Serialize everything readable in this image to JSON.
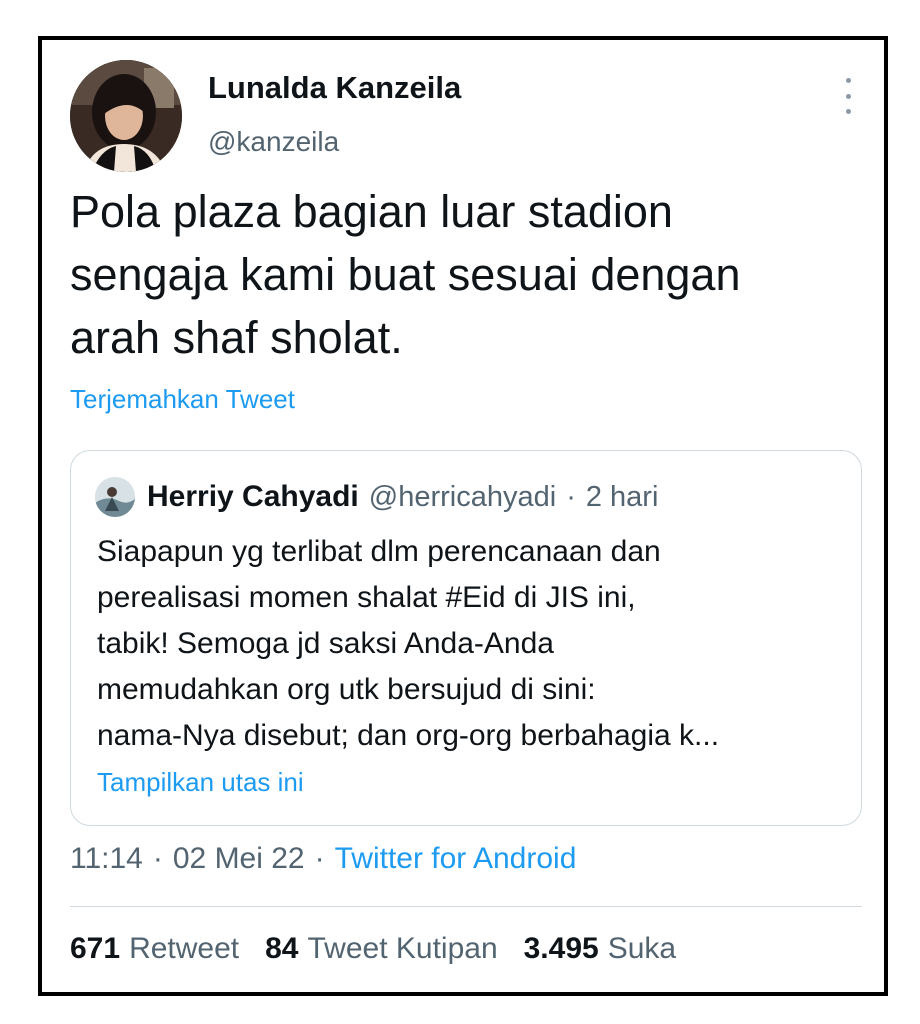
{
  "tweet": {
    "author_name": "Lunalda Kanzeila",
    "author_handle": "@kanzeila",
    "text_lines": [
      "Pola plaza bagian luar stadion",
      "sengaja kami buat sesuai dengan",
      "arah shaf sholat."
    ],
    "translate_label": "Terjemahkan Tweet",
    "time": "11:14",
    "date": "02 Mei 22",
    "source": "Twitter for Android",
    "separator": "·"
  },
  "quote": {
    "author_name": "Herriy Cahyadi",
    "author_handle": "@herricahyadi",
    "separator": "·",
    "time_ago": "2 hari",
    "text_lines": [
      "Siapapun yg terlibat dlm perencanaan dan",
      "perealisasi momen shalat #Eid di JIS ini,",
      "tabik! Semoga jd saksi Anda-Anda",
      "memudahkan org utk bersujud di sini:",
      "nama-Nya disebut; dan org-org berbahagia k..."
    ],
    "show_thread_label": "Tampilkan utas ini"
  },
  "stats": {
    "retweets_count": "671",
    "retweets_label": "Retweet",
    "quotes_count": "84",
    "quotes_label": "Tweet Kutipan",
    "likes_count": "3.495",
    "likes_label": "Suka"
  },
  "icons": {
    "more": "more-vertical-icon"
  },
  "colors": {
    "link": "#1d9bf0",
    "secondary_text": "#536471",
    "primary_text": "#0f1419",
    "border": "#cfd9de"
  }
}
